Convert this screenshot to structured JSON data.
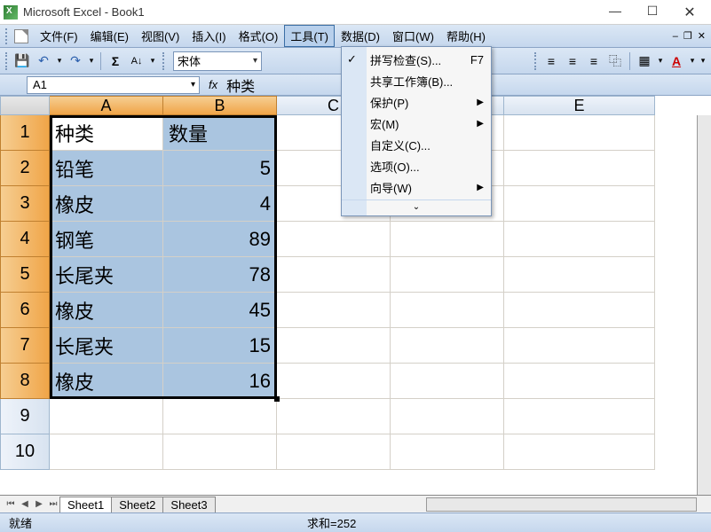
{
  "window": {
    "title": "Microsoft Excel - Book1"
  },
  "menu": {
    "file": "文件(F)",
    "edit": "编辑(E)",
    "view": "视图(V)",
    "insert": "插入(I)",
    "format": "格式(O)",
    "tools": "工具(T)",
    "data": "数据(D)",
    "windowm": "窗口(W)",
    "help": "帮助(H)"
  },
  "toolbar": {
    "font": "宋体"
  },
  "namebox": {
    "ref": "A1",
    "formula": "种类"
  },
  "columns": {
    "A": "A",
    "B": "B",
    "C": "C",
    "D": "D",
    "E": "E"
  },
  "col_widths": {
    "A": 128,
    "B": 128,
    "C": 128,
    "D": 128,
    "E": 170
  },
  "rows": [
    "1",
    "2",
    "3",
    "4",
    "5",
    "6",
    "7",
    "8",
    "9",
    "10"
  ],
  "cells": {
    "A1": "种类",
    "B1": "数量",
    "A2": "铅笔",
    "B2": "5",
    "A3": "橡皮",
    "B3": "4",
    "A4": "钢笔",
    "B4": "89",
    "A5": "长尾夹",
    "B5": "78",
    "A6": "橡皮",
    "B6": "45",
    "A7": "长尾夹",
    "B7": "15",
    "A8": "橡皮",
    "B8": "16"
  },
  "dropdown": {
    "spell": "拼写检查(S)...",
    "spell_sc": "F7",
    "share": "共享工作簿(B)...",
    "protect": "保护(P)",
    "macro": "宏(M)",
    "custom": "自定义(C)...",
    "options": "选项(O)...",
    "wizard": "向导(W)"
  },
  "sheets": {
    "s1": "Sheet1",
    "s2": "Sheet2",
    "s3": "Sheet3"
  },
  "status": {
    "ready": "就绪",
    "sum": "求和=252"
  },
  "chart_data": {
    "type": "table",
    "columns": [
      "种类",
      "数量"
    ],
    "rows": [
      [
        "铅笔",
        5
      ],
      [
        "橡皮",
        4
      ],
      [
        "钢笔",
        89
      ],
      [
        "长尾夹",
        78
      ],
      [
        "橡皮",
        45
      ],
      [
        "长尾夹",
        15
      ],
      [
        "橡皮",
        16
      ]
    ],
    "sum": 252
  }
}
